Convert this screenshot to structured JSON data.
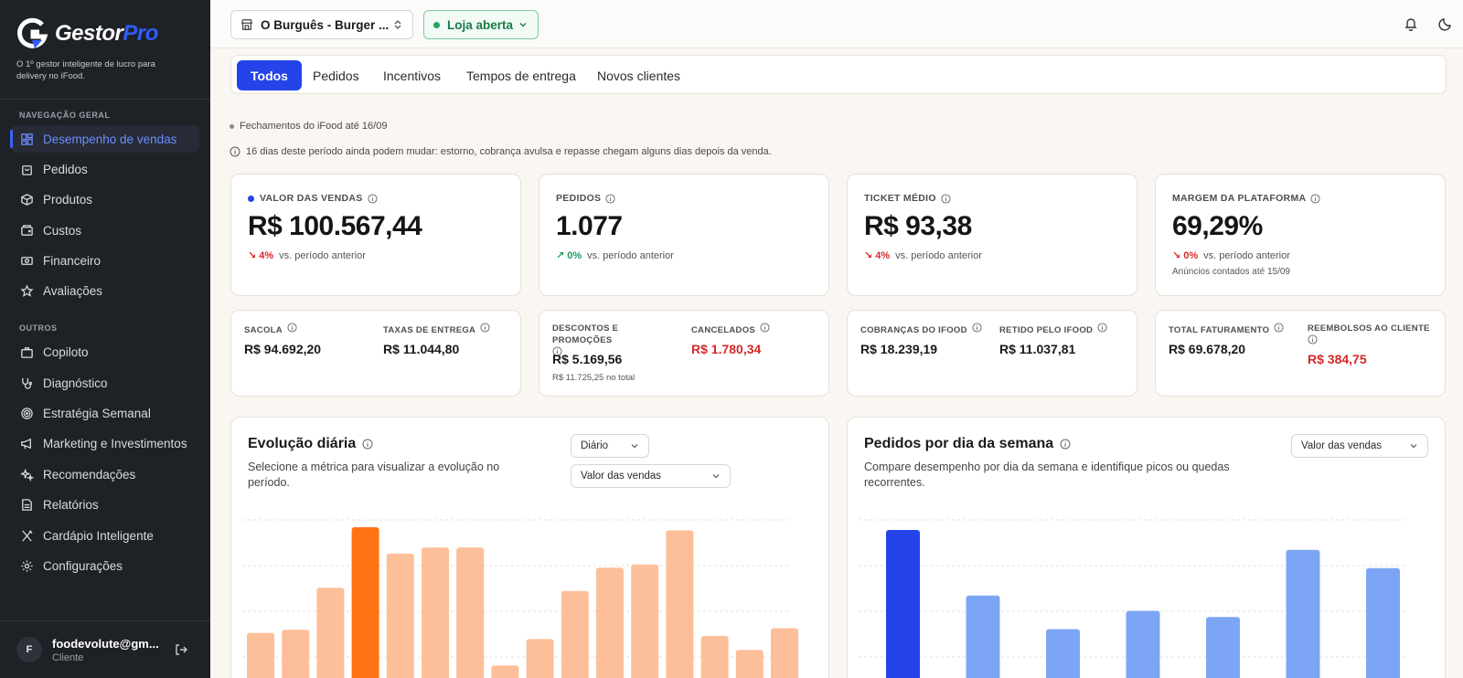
{
  "brand": {
    "name_main": "Gestor",
    "name_accent": "Pro",
    "tagline": "O 1º gestor inteligente de lucro para delivery no iFood."
  },
  "sidebar": {
    "section_main": "NAVEGAÇÃO GERAL",
    "section_other": "OUTROS",
    "items": [
      {
        "label": "Desempenho de vendas",
        "icon": "dashboard-icon"
      },
      {
        "label": "Pedidos",
        "icon": "bag-icon"
      },
      {
        "label": "Produtos",
        "icon": "box-icon"
      },
      {
        "label": "Custos",
        "icon": "wallet-icon"
      },
      {
        "label": "Financeiro",
        "icon": "money-icon"
      },
      {
        "label": "Avaliações",
        "icon": "star-icon"
      }
    ],
    "other_items": [
      {
        "label": "Copiloto",
        "icon": "briefcase-icon"
      },
      {
        "label": "Diagnóstico",
        "icon": "stethoscope-icon"
      },
      {
        "label": "Estratégia Semanal",
        "icon": "target-icon"
      },
      {
        "label": "Marketing e Investimentos",
        "icon": "megaphone-icon"
      },
      {
        "label": "Recomendações",
        "icon": "sparkles-icon"
      },
      {
        "label": "Relatórios",
        "icon": "document-icon"
      },
      {
        "label": "Cardápio Inteligente",
        "icon": "utensils-icon"
      },
      {
        "label": "Configurações",
        "icon": "gear-icon"
      }
    ],
    "user": {
      "initial": "F",
      "email": "foodevolute@gm...",
      "role": "Cliente"
    }
  },
  "topbar": {
    "store": "O Burguês - Burger ...",
    "status": "Loja aberta"
  },
  "tabs": [
    "Todos",
    "Pedidos",
    "Incentivos",
    "Tempos de entrega",
    "Novos clientes"
  ],
  "notes": {
    "closing": "Fechamentos do iFood até 16/09",
    "warning": "16 dias deste período ainda podem mudar: estorno, cobrança avulsa e repasse chegam alguns dias depois da venda."
  },
  "kpis": [
    {
      "label": "VALOR DAS VENDAS",
      "value": "R$ 100.567,44",
      "delta": "4%",
      "direction": "down",
      "compare": "vs. período anterior"
    },
    {
      "label": "PEDIDOS",
      "value": "1.077",
      "delta": "0%",
      "direction": "up",
      "compare": "vs. período anterior"
    },
    {
      "label": "TICKET MÉDIO",
      "value": "R$ 93,38",
      "delta": "4%",
      "direction": "down",
      "compare": "vs. período anterior"
    },
    {
      "label": "MARGEM DA PLATAFORMA",
      "value": "69,29%",
      "delta": "0%",
      "direction": "down",
      "compare": "vs. período anterior",
      "footnote": "Anúncios contados até 15/09"
    }
  ],
  "subcards": [
    {
      "a_label": "SACOLA",
      "a_value": "R$ 94.692,20",
      "b_label": "TAXAS DE ENTREGA",
      "b_value": "R$ 11.044,80"
    },
    {
      "a_label": "DESCONTOS E PROMOÇÕES",
      "a_value": "R$ 5.169,56",
      "a_foot": "R$ 11.725,25 no total",
      "b_label": "CANCELADOS",
      "b_value": "R$ 1.780,34"
    },
    {
      "a_label": "COBRANÇAS DO IFOOD",
      "a_value": "R$ 18.239,19",
      "b_label": "RETIDO PELO IFOOD",
      "b_value": "R$ 11.037,81"
    },
    {
      "a_label": "TOTAL FATURAMENTO",
      "a_value": "R$ 69.678,20",
      "b_label": "REEMBOLSOS AO CLIENTE",
      "b_value": "R$ 384,75"
    }
  ],
  "panels": {
    "daily": {
      "title": "Evolução diária",
      "desc": "Selecione a métrica para visualizar a evolução no período.",
      "period": "Diário",
      "metric": "Valor das vendas"
    },
    "weekday": {
      "title": "Pedidos por dia da semana",
      "desc": "Compare desempenho por dia da semana e identifique picos ou quedas recorrentes.",
      "metric": "Valor das vendas"
    }
  },
  "chart_data": [
    {
      "type": "bar",
      "values": [
        32,
        34,
        61,
        100,
        83,
        87,
        87,
        11,
        28,
        59,
        74,
        76,
        98,
        30,
        21,
        35
      ],
      "highlight_index": 3,
      "colors": {
        "bar": "#fdbf99",
        "highlight": "#ff7314"
      }
    },
    {
      "type": "bar",
      "values": [
        100,
        57,
        35,
        47,
        43,
        87,
        75
      ],
      "highlight_index": 0,
      "colors": {
        "bar": "#7da5f5",
        "highlight": "#2443e8"
      }
    }
  ]
}
